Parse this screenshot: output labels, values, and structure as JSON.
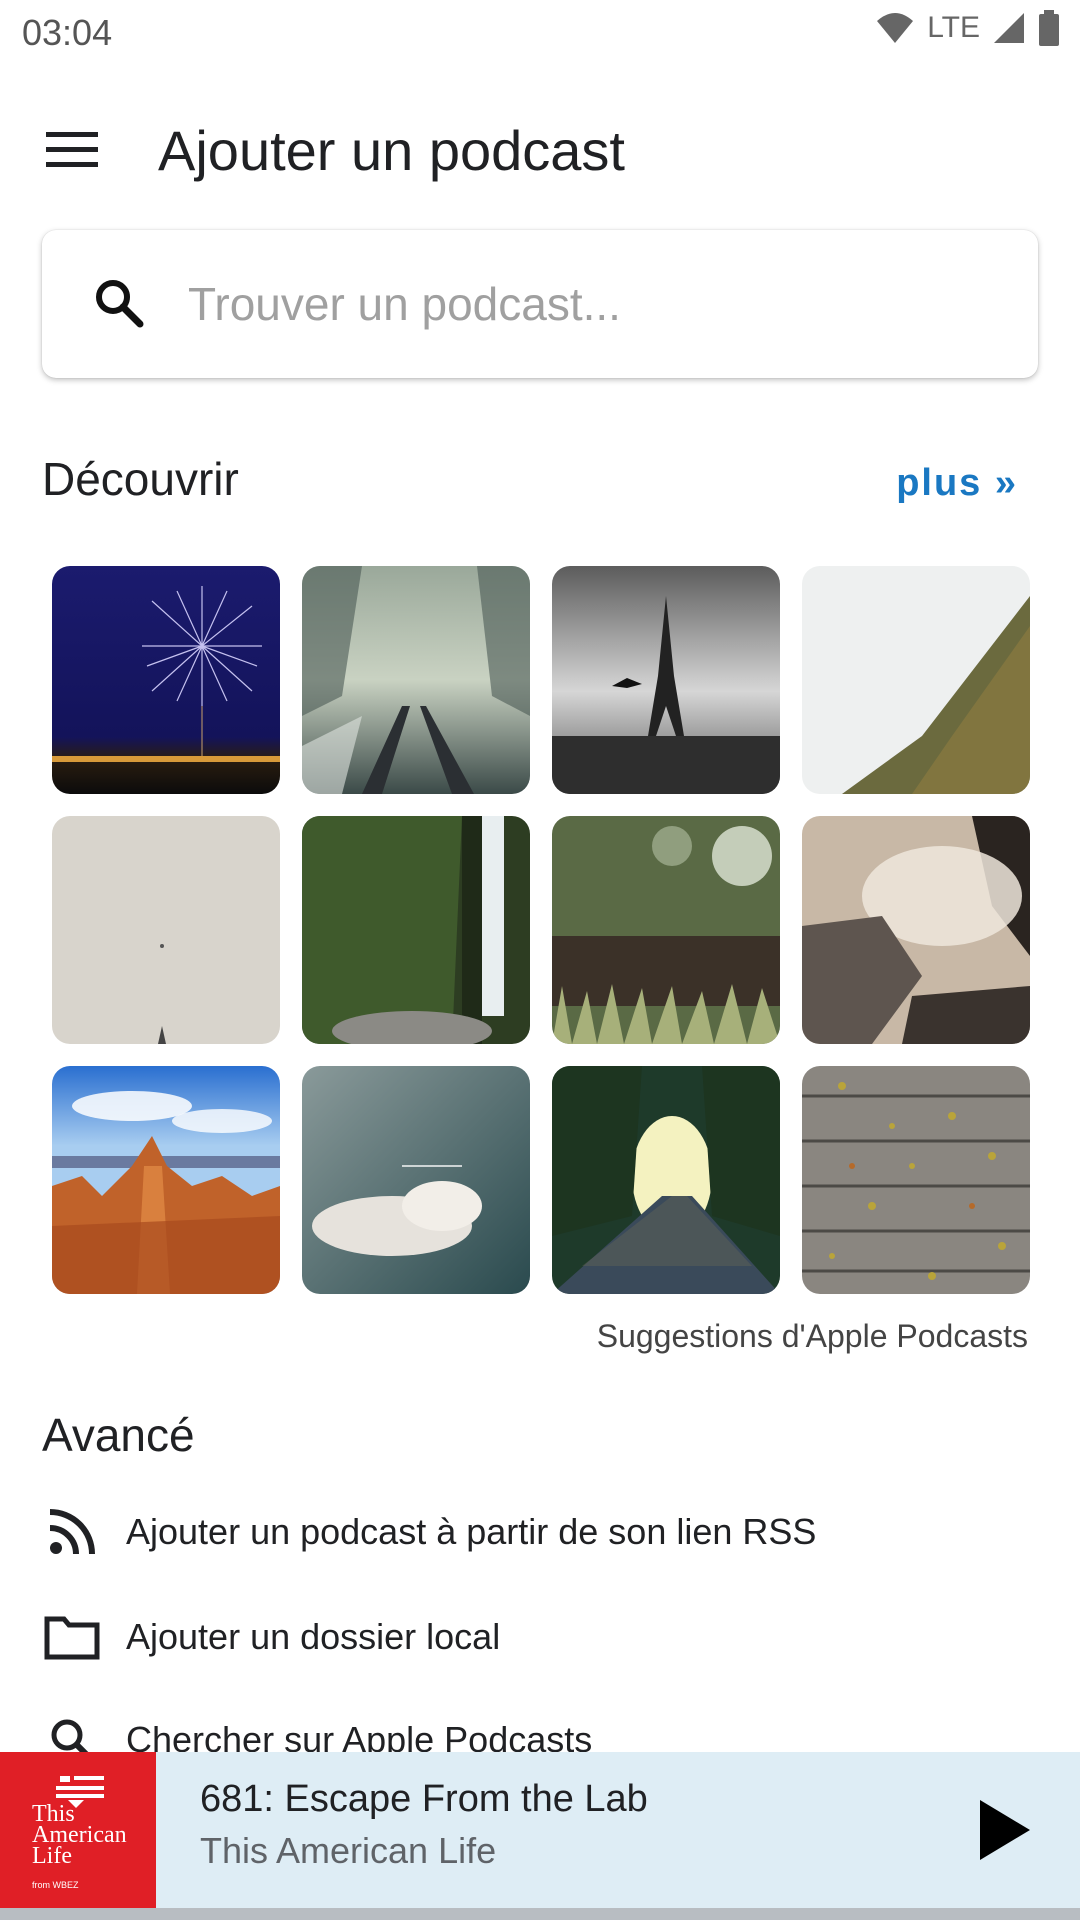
{
  "status_bar": {
    "time": "03:04",
    "network": "LTE"
  },
  "toolbar": {
    "title": "Ajouter un podcast"
  },
  "search": {
    "placeholder": "Trouver un podcast..."
  },
  "discover": {
    "title": "Découvrir",
    "more_label": "plus »",
    "caption": "Suggestions d'Apple Podcasts",
    "tiles": [
      "fireworks",
      "foggy-railway",
      "eiffel-tower",
      "misty-mountain",
      "cloudy-sky",
      "waterfall",
      "grass-bokeh",
      "steaming-rocks",
      "canyon-hoodoos",
      "clouds-teal",
      "sunlit-road",
      "wooden-planks"
    ]
  },
  "advanced": {
    "title": "Avancé",
    "items": [
      {
        "label": "Ajouter un podcast à partir de son lien RSS",
        "icon": "rss-icon"
      },
      {
        "label": "Ajouter un dossier local",
        "icon": "folder-icon"
      },
      {
        "label": "Chercher sur Apple Podcasts",
        "icon": "search-icon"
      }
    ]
  },
  "player": {
    "episode_title": "681: Escape From the Lab",
    "podcast_name": "This American Life",
    "artwork_text": "This American Life",
    "artwork_tiny": "from WBEZ",
    "accent_color": "#e01f26",
    "bar_color": "#deedf5"
  },
  "colors": {
    "link": "#1a78c2"
  }
}
